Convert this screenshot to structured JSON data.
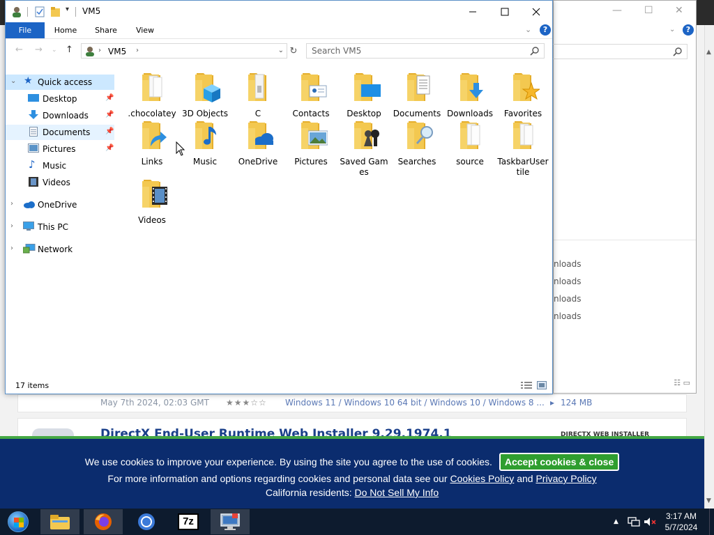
{
  "explorer": {
    "title": "VM5",
    "ribbon_tabs": [
      "File",
      "Home",
      "Share",
      "View"
    ],
    "address": "VM5",
    "search_placeholder": "Search VM5",
    "status": "17 items"
  },
  "nav": {
    "quick_access": "Quick access",
    "quick_items": [
      "Desktop",
      "Downloads",
      "Documents",
      "Pictures",
      "Music",
      "Videos"
    ],
    "roots": [
      "OneDrive",
      "This PC",
      "Network"
    ]
  },
  "folders": [
    {
      "name": ".chocolatey",
      "icon": "folder-plain-icon"
    },
    {
      "name": "3D Objects",
      "icon": "folder-3d-objects-icon"
    },
    {
      "name": "C",
      "icon": "folder-link-icon"
    },
    {
      "name": "Contacts",
      "icon": "folder-contacts-icon"
    },
    {
      "name": "Desktop",
      "icon": "folder-desktop-icon"
    },
    {
      "name": "Documents",
      "icon": "folder-documents-icon"
    },
    {
      "name": "Downloads",
      "icon": "folder-downloads-icon"
    },
    {
      "name": "Favorites",
      "icon": "folder-favorites-icon"
    },
    {
      "name": "Links",
      "icon": "folder-links-icon"
    },
    {
      "name": "Music",
      "icon": "folder-music-icon"
    },
    {
      "name": "OneDrive",
      "icon": "folder-onedrive-icon"
    },
    {
      "name": "Pictures",
      "icon": "folder-pictures-icon"
    },
    {
      "name": "Saved Games",
      "icon": "folder-saved-games-icon"
    },
    {
      "name": "Searches",
      "icon": "folder-searches-icon"
    },
    {
      "name": "source",
      "icon": "folder-plain-icon"
    },
    {
      "name": "TaskbarUsertile",
      "icon": "folder-plain-icon"
    },
    {
      "name": "Videos",
      "icon": "folder-videos-icon"
    }
  ],
  "background": {
    "list_lines": [
      "nloads",
      "nloads",
      "nloads",
      "nloads"
    ],
    "card_date": "May 7th 2024, 02:03 GMT",
    "card_os": "Windows 11 / Windows 10 64 bit / Windows 10 / Windows 8 ...",
    "card_size": "124 MB",
    "card2_title": "DirectX End-User Runtime Web Installer 9.29.1974.1",
    "card2_tag": "DIRECTX WEB INSTALLER"
  },
  "cookie": {
    "line1": "We use cookies to improve your experience. By using the site you agree to the use of cookies.",
    "accept": "Accept cookies & close",
    "line2_prefix": "For more information and options regarding cookies and personal data see our",
    "cookies_policy": "Cookies Policy",
    "and": "and",
    "privacy_policy": "Privacy Policy",
    "line3_prefix": "California residents:",
    "do_not_sell": "Do Not Sell My Info"
  },
  "taskbar": {
    "time": "3:17 AM",
    "date": "5/7/2024",
    "apps": [
      "file-explorer-icon",
      "firefox-icon",
      "chrome-icon",
      "7zip-icon",
      "remote-desktop-icon"
    ],
    "sevenzip_label": "7z"
  },
  "colors": {
    "accent": "#1c64c5",
    "folder": "#f3c850",
    "banner": "#0b2c6e",
    "accept": "#2f9e2f"
  }
}
